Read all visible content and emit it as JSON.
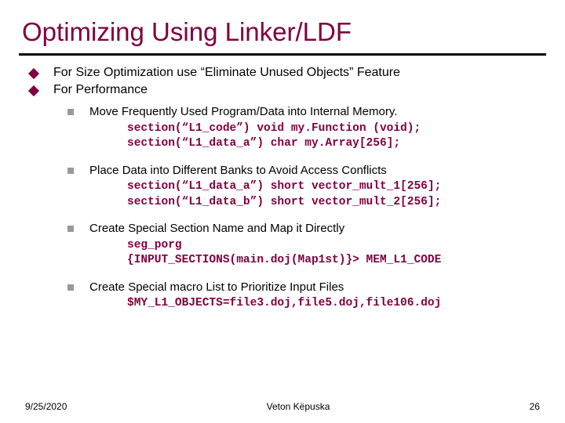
{
  "title": "Optimizing Using Linker/LDF",
  "bullets": [
    "For Size Optimization use “Eliminate Unused Objects” Feature",
    "For Performance"
  ],
  "subs": [
    {
      "text": "Move Frequently Used Program/Data into Internal Memory.",
      "code": "section(“L1_code”) void my.Function (void);\nsection(“L1_data_a”) char my.Array[256];"
    },
    {
      "text": "Place Data into Different Banks to Avoid Access Conflicts",
      "code": "section(“L1_data_a”) short vector_mult_1[256];\nsection(“L1_data_b”) short vector_mult_2[256];"
    },
    {
      "text": "Create Special Section Name and Map it Directly",
      "code": "seg_porg\n{INPUT_SECTIONS(main.doj(Map1st)}> MEM_L1_CODE"
    },
    {
      "text": "Create Special macro List to Prioritize Input Files",
      "code": "$MY_L1_OBJECTS=file3.doj,file5.doj,file106.doj\n"
    }
  ],
  "footer": {
    "date": "9/25/2020",
    "author": "Veton Këpuska",
    "page": "26"
  }
}
